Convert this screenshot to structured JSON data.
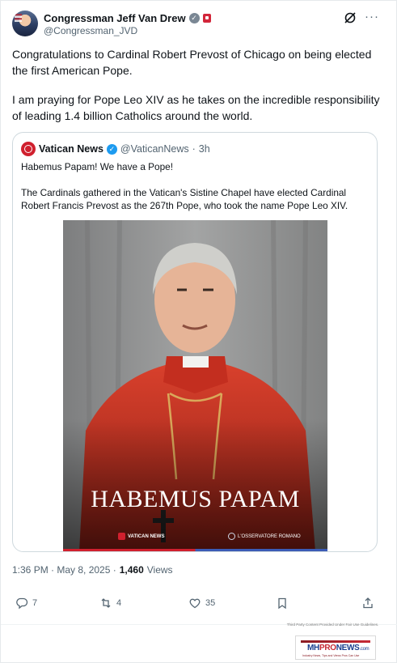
{
  "post": {
    "display_name": "Congressman Jeff Van Drew",
    "handle": "@Congressman_JVD",
    "paragraphs": [
      "Congratulations to Cardinal Robert Prevost of Chicago on being elected the first American Pope.",
      "I am praying for Pope Leo XIV as he takes on the incredible responsibility of leading 1.4 billion Catholics around the world."
    ],
    "timestamp": "1:36 PM · May 8, 2025 ·",
    "views_count": "1,460",
    "views_label": "Views"
  },
  "quote": {
    "display_name": "Vatican News",
    "handle": "@VaticanNews",
    "separator": "·",
    "time": "3h",
    "paragraphs": [
      "Habemus Papam! We have a Pope!",
      "The Cardinals gathered in the Vatican's Sistine Chapel have elected Cardinal Robert Francis Prevost as the 267th Pope, who took the name Pope Leo XIV."
    ],
    "image": {
      "caption": "HABEMUS PAPAM",
      "logo_left": "VATICAN NEWS",
      "logo_right": "L'OSSERVATORE ROMANO"
    }
  },
  "actions": {
    "reply_count": "7",
    "repost_count": "4",
    "like_count": "35"
  },
  "watermark": {
    "note": "Third Party Content Provided Under Fair Use Guidelines.",
    "brand_a": "MH",
    "brand_b": "PRO",
    "brand_c": "NEWS",
    "brand_suffix": ".com",
    "tagline": "Industry News, Tips and Views Pros Can Use"
  },
  "colors": {
    "text": "#0f1419",
    "secondary": "#536471",
    "verified_blue": "#1d9bf0",
    "verified_gray": "#7a8794",
    "vatican_red": "#d0202e",
    "card_border": "#cfd9de"
  }
}
